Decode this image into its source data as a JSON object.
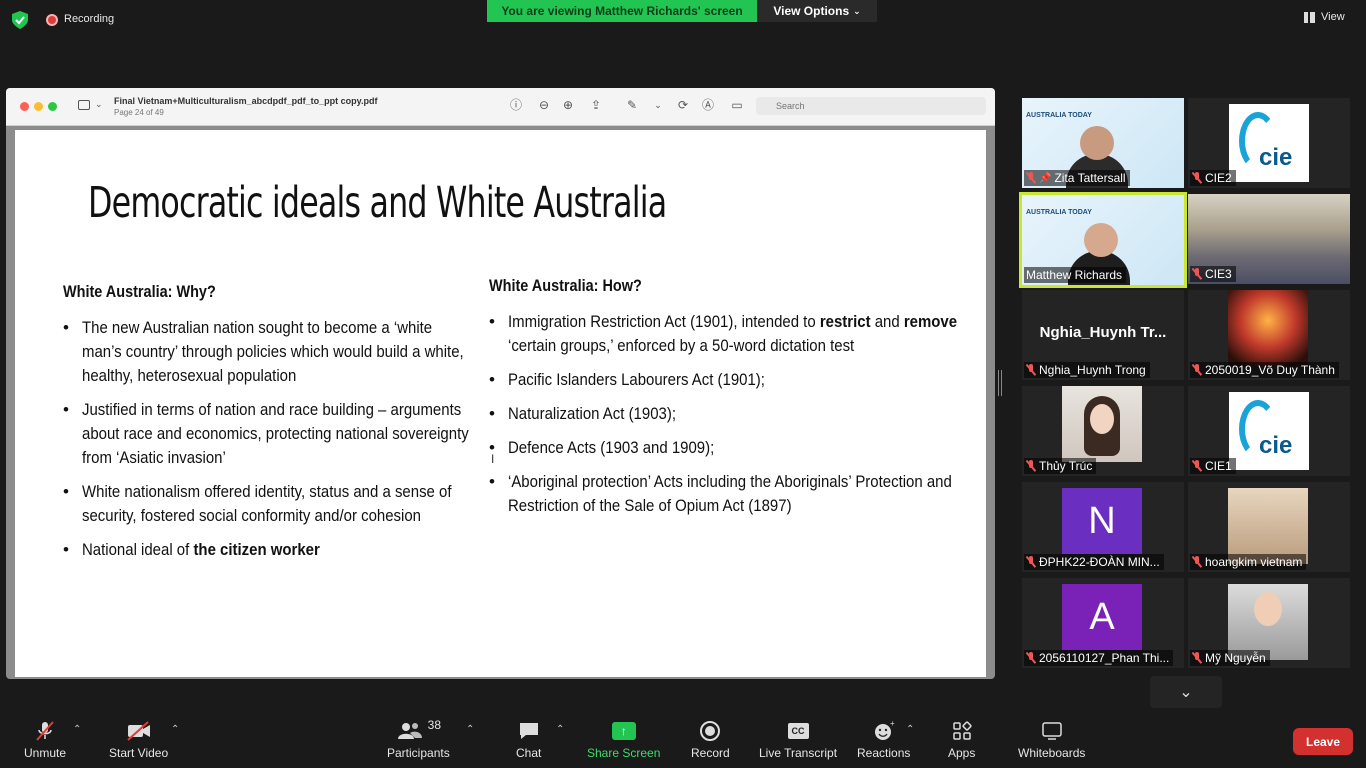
{
  "topbar": {
    "recording_label": "Recording",
    "viewing_banner": "You are viewing Matthew Richards' screen",
    "view_options_label": "View Options",
    "view_label": "View"
  },
  "pdf": {
    "title": "Final Vietnam+Multiculturalism_abcdpdf_pdf_to_ppt copy.pdf",
    "page_info": "Page 24 of 49",
    "search_placeholder": "Search"
  },
  "slide": {
    "title": "Democratic ideals and White Australia",
    "left_heading": "White Australia: Why?",
    "left_bullets": [
      {
        "text": "The new Australian nation sought to become a ‘white man’s country’ through policies which would build a white, healthy, heterosexual population",
        "bold": ""
      },
      {
        "text": "Justified in terms of nation and race building – arguments about race and economics, protecting national sovereignty from ‘Asiatic invasion’",
        "bold": ""
      },
      {
        "text": "White nationalism offered identity, status and a sense of security, fostered social conformity and/or cohesion",
        "bold": ""
      },
      {
        "text": "National ideal of ",
        "bold": "the citizen worker"
      }
    ],
    "right_heading": "White Australia: How?",
    "right_bullets": {
      "b1_pre": "Immigration Restriction Act (1901), intended to ",
      "b1_bold1": "restrict",
      "b1_mid": " and ",
      "b1_bold2": "remove",
      "b1_post": " ‘certain groups,’ enforced by a 50-word dictation test",
      "b2": "Pacific Islanders Labourers Act (1901);",
      "b3": "Naturalization Act (1903);",
      "b4": "Defence Acts (1903 and 1909);",
      "b5": "‘Aboriginal protection’ Acts including the Aboriginals’ Protection and Restriction of the Sale of Opium Act (1897)"
    }
  },
  "gallery": {
    "at_label": "AUSTRALIA TODAY",
    "tiles": [
      {
        "name": "Zita Tattersall"
      },
      {
        "name": "CIE2"
      },
      {
        "name": "Matthew Richards"
      },
      {
        "name": "CIE3"
      },
      {
        "name": "Nghia_Huynh Trong",
        "display": "Nghia_Huynh  Tr..."
      },
      {
        "name": "2050019_Võ Duy Thành"
      },
      {
        "name": "Thủy Trúc"
      },
      {
        "name": "CIE1"
      },
      {
        "name": "ĐPHK22-ĐOÀN MIN...",
        "letter": "N"
      },
      {
        "name": "hoangkim vietnam"
      },
      {
        "name": "2056110127_Phan Thi...",
        "letter": "A"
      },
      {
        "name": "Mỹ Nguyễn"
      }
    ],
    "cie_text": "cie"
  },
  "controls": {
    "unmute": "Unmute",
    "start_video": "Start Video",
    "participants": "Participants",
    "participants_count": "38",
    "chat": "Chat",
    "share_screen": "Share Screen",
    "record": "Record",
    "live_transcript": "Live Transcript",
    "cc": "CC",
    "reactions": "Reactions",
    "apps": "Apps",
    "whiteboards": "Whiteboards",
    "leave": "Leave"
  },
  "colors": {
    "banner_green": "#23c552",
    "leave_red": "#d33030",
    "active_speaker": "#c8e632",
    "avatar_n": "#6a2fc0",
    "avatar_a": "#7a22b8"
  }
}
